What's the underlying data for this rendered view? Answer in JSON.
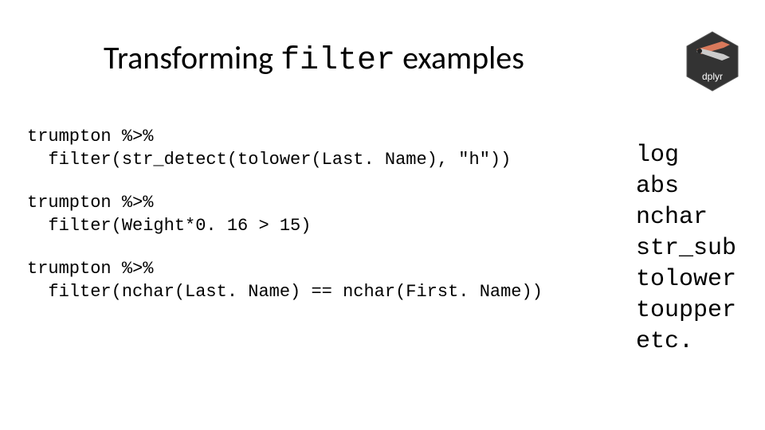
{
  "title": {
    "prefix": "Transforming ",
    "mono": "filter",
    "suffix": " examples"
  },
  "logo": {
    "label": "dplyr",
    "bg": "#333333",
    "accent": "#d9795b"
  },
  "code": {
    "ex1": "trumpton %>%\n  filter(str_detect(tolower(Last. Name), \"h\"))",
    "ex2": "trumpton %>%\n  filter(Weight*0. 16 > 15)",
    "ex3": "trumpton %>%\n  filter(nchar(Last. Name) == nchar(First. Name))"
  },
  "functions": "log\nabs\nnchar\nstr_sub\ntolower\ntoupper\netc."
}
